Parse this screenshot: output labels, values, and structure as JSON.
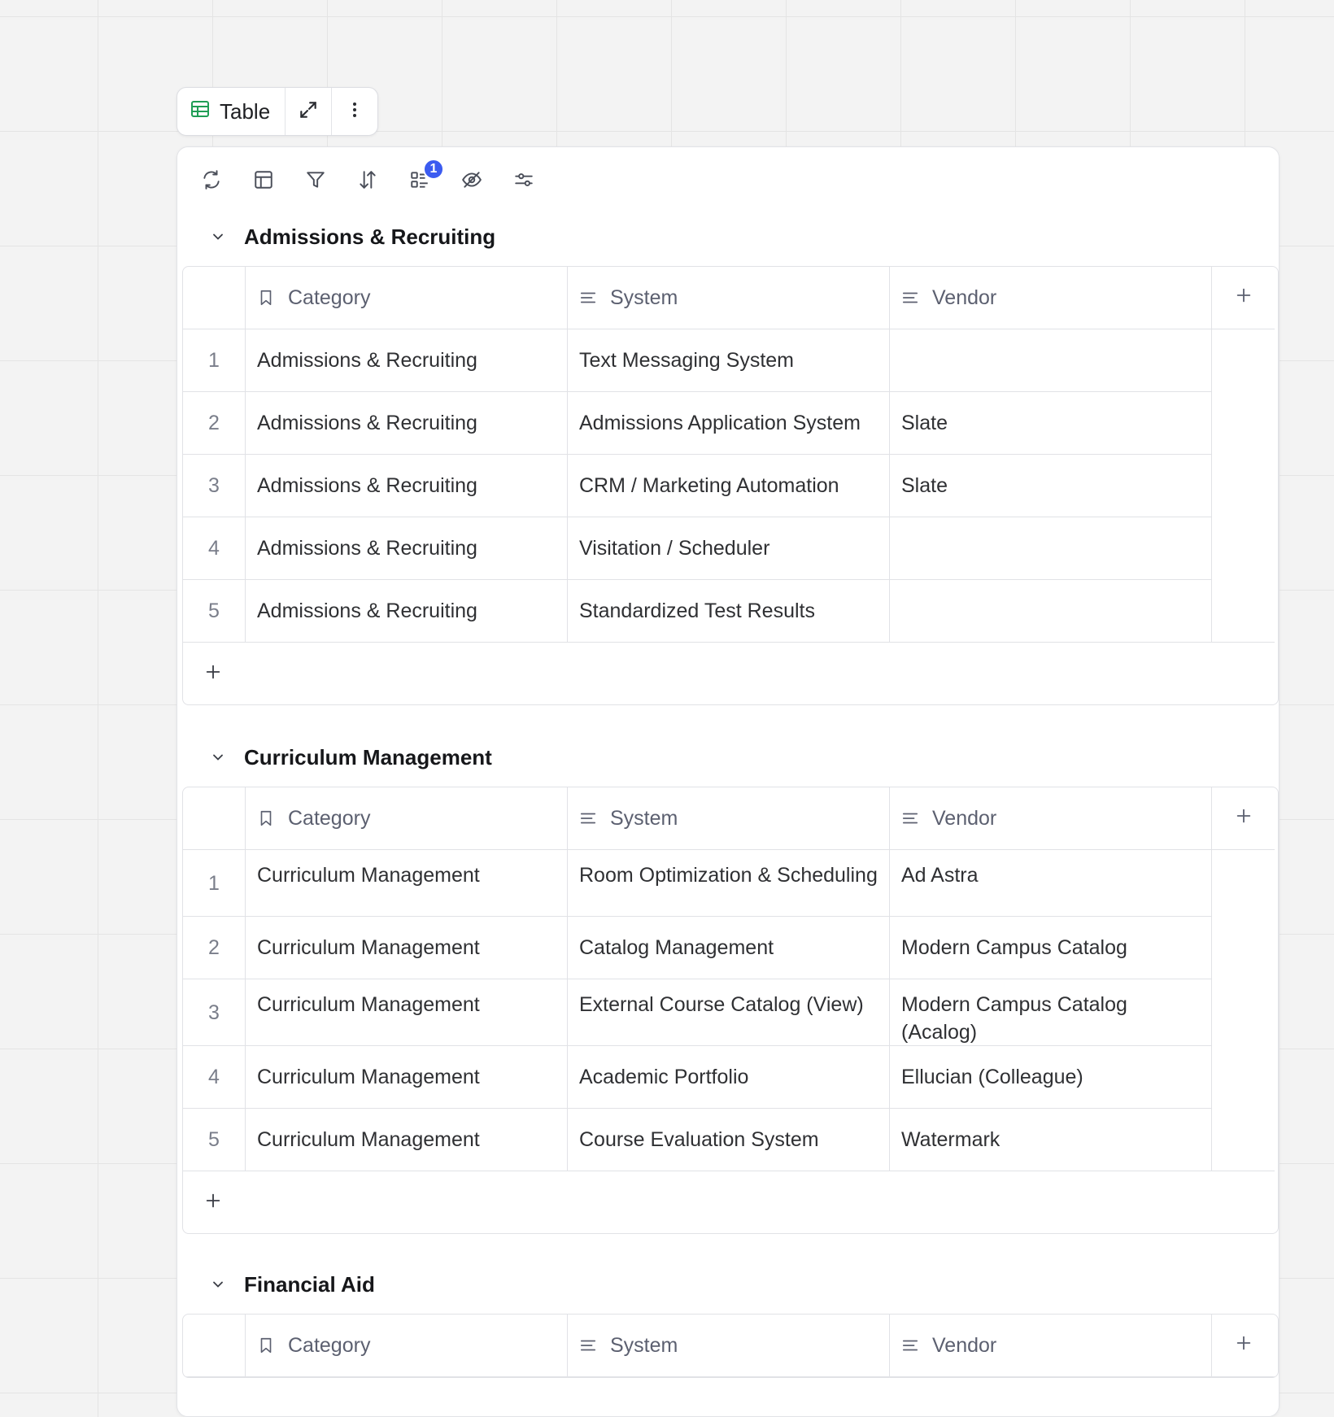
{
  "pill": {
    "table_label": "Table"
  },
  "toolbar": {
    "group_badge": "1"
  },
  "columns": [
    "Category",
    "System",
    "Vendor"
  ],
  "groups": [
    {
      "title": "Admissions & Recruiting",
      "rows": [
        {
          "num": "1",
          "category": "Admissions & Recruiting",
          "system": "Text Messaging System",
          "vendor": ""
        },
        {
          "num": "2",
          "category": "Admissions & Recruiting",
          "system": "Admissions Application System",
          "vendor": "Slate"
        },
        {
          "num": "3",
          "category": "Admissions & Recruiting",
          "system": "CRM / Marketing Automation",
          "vendor": "Slate"
        },
        {
          "num": "4",
          "category": "Admissions & Recruiting",
          "system": "Visitation / Scheduler",
          "vendor": ""
        },
        {
          "num": "5",
          "category": "Admissions & Recruiting",
          "system": "Standardized Test Results",
          "vendor": ""
        }
      ]
    },
    {
      "title": "Curriculum Management",
      "rows": [
        {
          "num": "1",
          "category": "Curriculum Management",
          "system": "Room Optimization & Scheduling",
          "vendor": "Ad Astra"
        },
        {
          "num": "2",
          "category": "Curriculum Management",
          "system": "Catalog Management",
          "vendor": "Modern Campus Catalog"
        },
        {
          "num": "3",
          "category": "Curriculum Management",
          "system": "External Course Catalog (View)",
          "vendor": "Modern Campus Catalog (Acalog)"
        },
        {
          "num": "4",
          "category": "Curriculum Management",
          "system": "Academic Portfolio",
          "vendor": "Ellucian (Colleague)"
        },
        {
          "num": "5",
          "category": "Curriculum Management",
          "system": "Course Evaluation System",
          "vendor": "Watermark"
        }
      ]
    },
    {
      "title": "Financial Aid",
      "rows": []
    }
  ]
}
